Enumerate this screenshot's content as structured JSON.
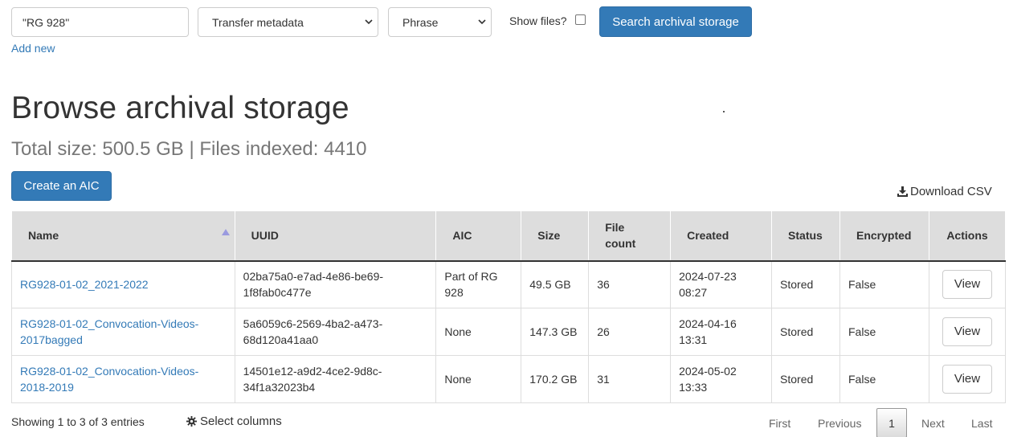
{
  "search": {
    "query": "\"RG 928\"",
    "field": "Transfer metadata",
    "type": "Phrase",
    "show_files_label": "Show files?",
    "show_files_checked": false,
    "submit_label": "Search archival storage",
    "add_new_label": "Add new"
  },
  "page": {
    "title": "Browse archival storage",
    "subtitle": "Total size: 500.5 GB | Files indexed: 4410",
    "create_aic_label": "Create an AIC",
    "download_csv_label": "Download CSV"
  },
  "table": {
    "headers": {
      "name": "Name",
      "uuid": "UUID",
      "aic": "AIC",
      "size": "Size",
      "file_count_1": "File",
      "file_count_2": "count",
      "created": "Created",
      "status": "Status",
      "encrypted": "Encrypted",
      "actions": "Actions"
    },
    "rows": [
      {
        "name_1": "RG928-01-02_2021-2022",
        "name_2": "",
        "uuid_1": "02ba75a0-e7ad-4e86-be69-",
        "uuid_2": "1f8fab0c477e",
        "aic_1": "Part of RG",
        "aic_2": "928",
        "size": "49.5 GB",
        "file_count": "36",
        "created_1": "2024-07-23",
        "created_2": "08:27",
        "status": "Stored",
        "encrypted": "False",
        "action": "View"
      },
      {
        "name_1": "RG928-01-02_Convocation-Videos-",
        "name_2": "2017bagged",
        "uuid_1": "5a6059c6-2569-4ba2-a473-",
        "uuid_2": "68d120a41aa0",
        "aic_1": "None",
        "aic_2": "",
        "size": "147.3 GB",
        "file_count": "26",
        "created_1": "2024-04-16",
        "created_2": "13:31",
        "status": "Stored",
        "encrypted": "False",
        "action": "View"
      },
      {
        "name_1": "RG928-01-02_Convocation-Videos-",
        "name_2": "2018-2019",
        "uuid_1": "14501e12-a9d2-4ce2-9d8c-",
        "uuid_2": "34f1a32023b4",
        "aic_1": "None",
        "aic_2": "",
        "size": "170.2 GB",
        "file_count": "31",
        "created_1": "2024-05-02",
        "created_2": "13:33",
        "status": "Stored",
        "encrypted": "False",
        "action": "View"
      }
    ]
  },
  "footer": {
    "showing": "Showing 1 to 3 of 3 entries",
    "select_columns": "Select columns",
    "pager": {
      "first": "First",
      "previous": "Previous",
      "current": "1",
      "next": "Next",
      "last": "Last"
    }
  },
  "colors": {
    "primary": "#337ab7",
    "header_bg": "#dddddd",
    "subtitle": "#777777"
  }
}
